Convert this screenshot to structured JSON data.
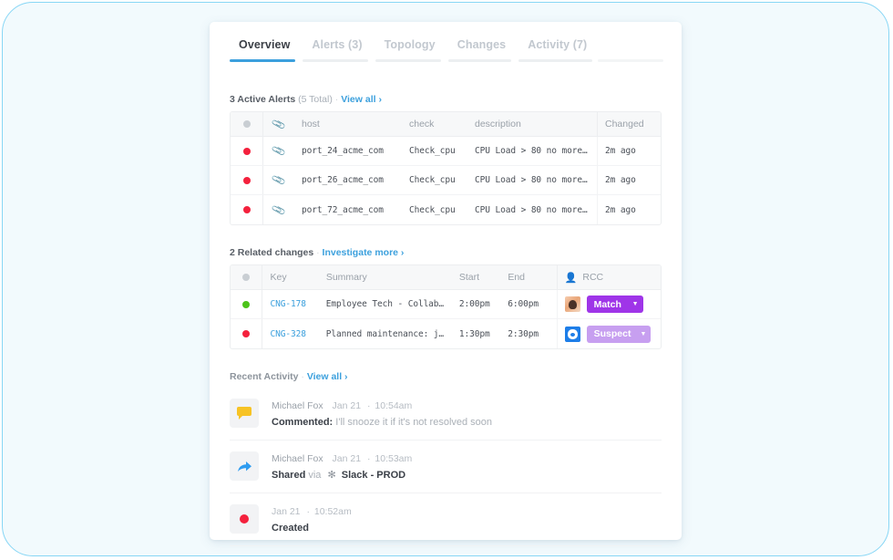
{
  "tabs": [
    {
      "label": "Overview",
      "active": true
    },
    {
      "label": "Alerts (3)",
      "active": false
    },
    {
      "label": "Topology",
      "active": false
    },
    {
      "label": "Changes",
      "active": false
    },
    {
      "label": "Activity (7)",
      "active": false
    }
  ],
  "alerts_section": {
    "title": "3 Active Alerts",
    "subtitle": "(5 Total)",
    "separator": "·",
    "link": "View all ›",
    "columns": [
      "",
      "",
      "host",
      "check",
      "description",
      "Changed"
    ],
    "rows": [
      {
        "status": "red",
        "host": "port_24_acme_com",
        "check": "Check_cpu",
        "description": "CPU Load > 80 no more…",
        "changed": "2m ago"
      },
      {
        "status": "red",
        "host": "port_26_acme_com",
        "check": "Check_cpu",
        "description": "CPU Load > 80 no more…",
        "changed": "2m ago"
      },
      {
        "status": "red",
        "host": "port_72_acme_com",
        "check": "Check_cpu",
        "description": "CPU Load > 80 no more…",
        "changed": "2m ago"
      }
    ]
  },
  "changes_section": {
    "title": "2 Related changes",
    "separator": "·",
    "link": "Investigate more ›",
    "columns": [
      "",
      "Key",
      "Summary",
      "Start",
      "End",
      "RCC"
    ],
    "rows": [
      {
        "status": "green",
        "key": "CNG-178",
        "summary": "Employee Tech - Collab…",
        "start": "2:00pm",
        "end": "6:00pm",
        "avatar": "photo",
        "badge_label": "Match",
        "badge_color": "#9f35e8"
      },
      {
        "status": "red",
        "key": "CNG-328",
        "summary": "Planned maintenance: j…",
        "start": "1:30pm",
        "end": "2:30pm",
        "avatar": "blue",
        "badge_label": "Suspect",
        "badge_color": "#c79ff0"
      }
    ]
  },
  "activity_section": {
    "title": "Recent Activity",
    "separator": "·",
    "link": "View all ›",
    "items": [
      {
        "icon": "comment-icon",
        "user": "Michael Fox",
        "date": "Jan 21",
        "time_sep": "·",
        "time": "10:54am",
        "verb": "Commented:",
        "text": "I'll snooze it if it's not resolved soon"
      },
      {
        "icon": "share-icon",
        "user": "Michael Fox",
        "date": "Jan 21",
        "time_sep": "·",
        "time": "10:53am",
        "verb": "Shared",
        "via": "via",
        "destination": "Slack - PROD"
      },
      {
        "icon": "alert-dot-icon",
        "user": "",
        "date": "Jan 21",
        "time_sep": "·",
        "time": "10:52am",
        "verb": "Created",
        "text": ""
      }
    ]
  },
  "colors": {
    "accent_blue": "#3ca0dd",
    "alert_red": "#f4213d",
    "ok_green": "#4cc319",
    "match_purple": "#9f35e8",
    "suspect_purple": "#c79ff0",
    "page_bg": "#f2fafd"
  }
}
